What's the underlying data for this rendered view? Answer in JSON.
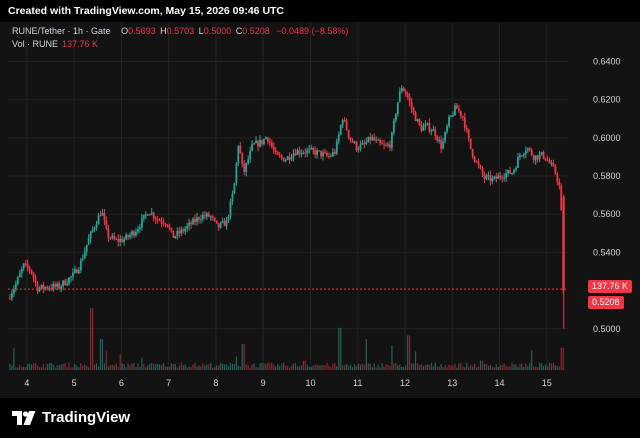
{
  "header": {
    "created": "Created with TradingView.com, May 15, 2026 09:46 UTC"
  },
  "legend": {
    "symbol": "RUNE/Tether · 1h · Gate",
    "o_label": "O",
    "o": "0.5693",
    "h_label": "H",
    "h": "0.5703",
    "l_label": "L",
    "l": "0.5000",
    "c_label": "C",
    "c": "0.5208",
    "change": "−0.0489 (−8.58%)",
    "vol_label": "Vol · RUNE",
    "vol": "137.76 K"
  },
  "badges": {
    "volume": "137.76 K",
    "price": "0.5208"
  },
  "footer": {
    "brand": "TradingView"
  },
  "colors": {
    "up": "#26a69a",
    "down": "#f23645",
    "background": "#131313",
    "grid": "#232323",
    "text": "#d1d4dc"
  },
  "chart_data": {
    "type": "candlestick",
    "price_axis": {
      "ticks": [
        "0.6400",
        "0.6200",
        "0.6000",
        "0.5800",
        "0.5600",
        "0.5400",
        "0.5000"
      ],
      "range": [
        0.4915,
        0.6455
      ],
      "side": "right"
    },
    "x_axis": {
      "ticks": [
        "4",
        "5",
        "6",
        "7",
        "8",
        "9",
        "10",
        "11",
        "12",
        "13",
        "14",
        "15"
      ],
      "range_days": [
        3.6,
        15.45
      ]
    },
    "last_price": 0.5208,
    "last_volume": "137.76 K",
    "grid": true,
    "price_path": [
      [
        3.62,
        0.516
      ],
      [
        3.8,
        0.524
      ],
      [
        3.95,
        0.533
      ],
      [
        4.1,
        0.531
      ],
      [
        4.25,
        0.521
      ],
      [
        4.45,
        0.522
      ],
      [
        4.7,
        0.522
      ],
      [
        5.0,
        0.528
      ],
      [
        5.15,
        0.534
      ],
      [
        5.3,
        0.545
      ],
      [
        5.45,
        0.554
      ],
      [
        5.6,
        0.562
      ],
      [
        5.72,
        0.549
      ],
      [
        5.9,
        0.546
      ],
      [
        6.1,
        0.547
      ],
      [
        6.3,
        0.551
      ],
      [
        6.45,
        0.556
      ],
      [
        6.6,
        0.562
      ],
      [
        6.8,
        0.557
      ],
      [
        6.98,
        0.556
      ],
      [
        7.1,
        0.548
      ],
      [
        7.3,
        0.551
      ],
      [
        7.5,
        0.555
      ],
      [
        7.7,
        0.559
      ],
      [
        7.9,
        0.559
      ],
      [
        8.05,
        0.553
      ],
      [
        8.25,
        0.556
      ],
      [
        8.4,
        0.573
      ],
      [
        8.5,
        0.598
      ],
      [
        8.6,
        0.581
      ],
      [
        8.8,
        0.596
      ],
      [
        9.0,
        0.598
      ],
      [
        9.1,
        0.601
      ],
      [
        9.3,
        0.59
      ],
      [
        9.5,
        0.589
      ],
      [
        9.7,
        0.593
      ],
      [
        10.0,
        0.593
      ],
      [
        10.2,
        0.592
      ],
      [
        10.4,
        0.59
      ],
      [
        10.55,
        0.593
      ],
      [
        10.7,
        0.611
      ],
      [
        10.85,
        0.6
      ],
      [
        11.0,
        0.595
      ],
      [
        11.15,
        0.596
      ],
      [
        11.3,
        0.6
      ],
      [
        11.45,
        0.597
      ],
      [
        11.6,
        0.595
      ],
      [
        11.72,
        0.597
      ],
      [
        11.85,
        0.617
      ],
      [
        11.95,
        0.627
      ],
      [
        12.05,
        0.623
      ],
      [
        12.2,
        0.613
      ],
      [
        12.35,
        0.605
      ],
      [
        12.5,
        0.606
      ],
      [
        12.65,
        0.603
      ],
      [
        12.8,
        0.595
      ],
      [
        12.95,
        0.609
      ],
      [
        13.1,
        0.616
      ],
      [
        13.25,
        0.611
      ],
      [
        13.4,
        0.595
      ],
      [
        13.55,
        0.586
      ],
      [
        13.7,
        0.579
      ],
      [
        13.9,
        0.578
      ],
      [
        14.1,
        0.581
      ],
      [
        14.3,
        0.582
      ],
      [
        14.45,
        0.591
      ],
      [
        14.6,
        0.595
      ],
      [
        14.75,
        0.59
      ],
      [
        14.95,
        0.591
      ],
      [
        15.1,
        0.586
      ],
      [
        15.22,
        0.581
      ],
      [
        15.32,
        0.571
      ],
      [
        15.36,
        0.5208
      ]
    ],
    "volume_peaks": [
      [
        3.7,
        0.35
      ],
      [
        5.35,
        1.0
      ],
      [
        5.55,
        0.5
      ],
      [
        5.65,
        0.3
      ],
      [
        5.95,
        0.25
      ],
      [
        6.4,
        0.2
      ],
      [
        7.25,
        0.12
      ],
      [
        8.4,
        0.22
      ],
      [
        8.55,
        0.42
      ],
      [
        9.85,
        0.15
      ],
      [
        10.6,
        0.68
      ],
      [
        11.15,
        0.5
      ],
      [
        11.7,
        0.4
      ],
      [
        12.05,
        0.56
      ],
      [
        12.2,
        0.3
      ],
      [
        13.6,
        0.15
      ],
      [
        14.65,
        0.32
      ],
      [
        15.3,
        0.36
      ],
      [
        15.36,
        1.0
      ]
    ]
  }
}
